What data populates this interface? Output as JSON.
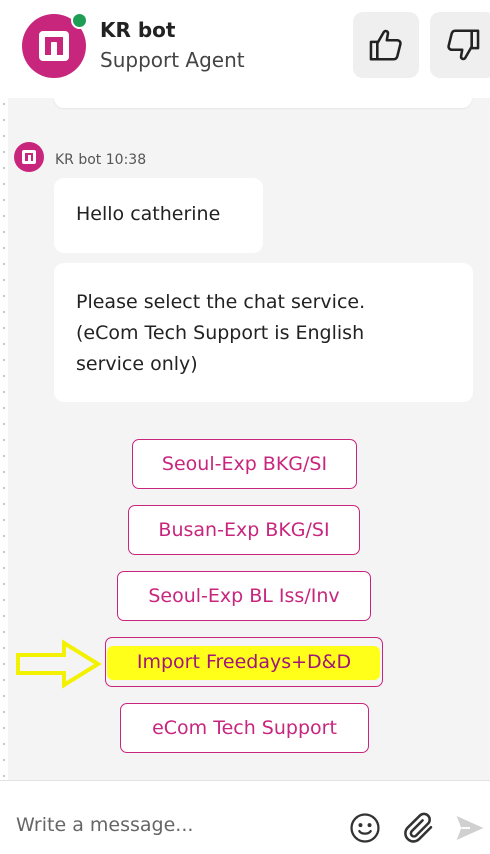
{
  "header": {
    "bot_name": "KR bot",
    "bot_role": "Support Agent",
    "status": "online",
    "actions": [
      {
        "name": "thumbs-up",
        "icon": "thumbs-up-icon"
      },
      {
        "name": "thumbs-down",
        "icon": "thumbs-down-icon"
      }
    ]
  },
  "colors": {
    "brand": "#c8267d",
    "online": "#1f9d55",
    "highlight": "#ffff1a",
    "chat_bg": "#f4f4f4"
  },
  "messages": [
    {
      "sender": "KR bot",
      "time": "10:38",
      "meta": "KR bot 10:38",
      "texts": [
        "Hello catherine",
        "Please select the chat service. (eCom Tech Support is English service only)"
      ],
      "bubble2_lines": [
        "Please select the chat service.",
        "(eCom Tech Support is English",
        "service only)"
      ]
    }
  ],
  "options": [
    "Seoul-Exp BKG/SI",
    "Busan-Exp BKG/SI",
    "Seoul-Exp BL Iss/Inv",
    "Import Freedays+D&D",
    "eCom Tech Support"
  ],
  "annotation": {
    "highlighted_option": "Import Freedays+D&D",
    "arrow_icon": "yellow-arrow-icon"
  },
  "composer": {
    "placeholder": "Write a message...",
    "icons": [
      "emoji-icon",
      "paperclip-icon",
      "send-icon"
    ]
  }
}
